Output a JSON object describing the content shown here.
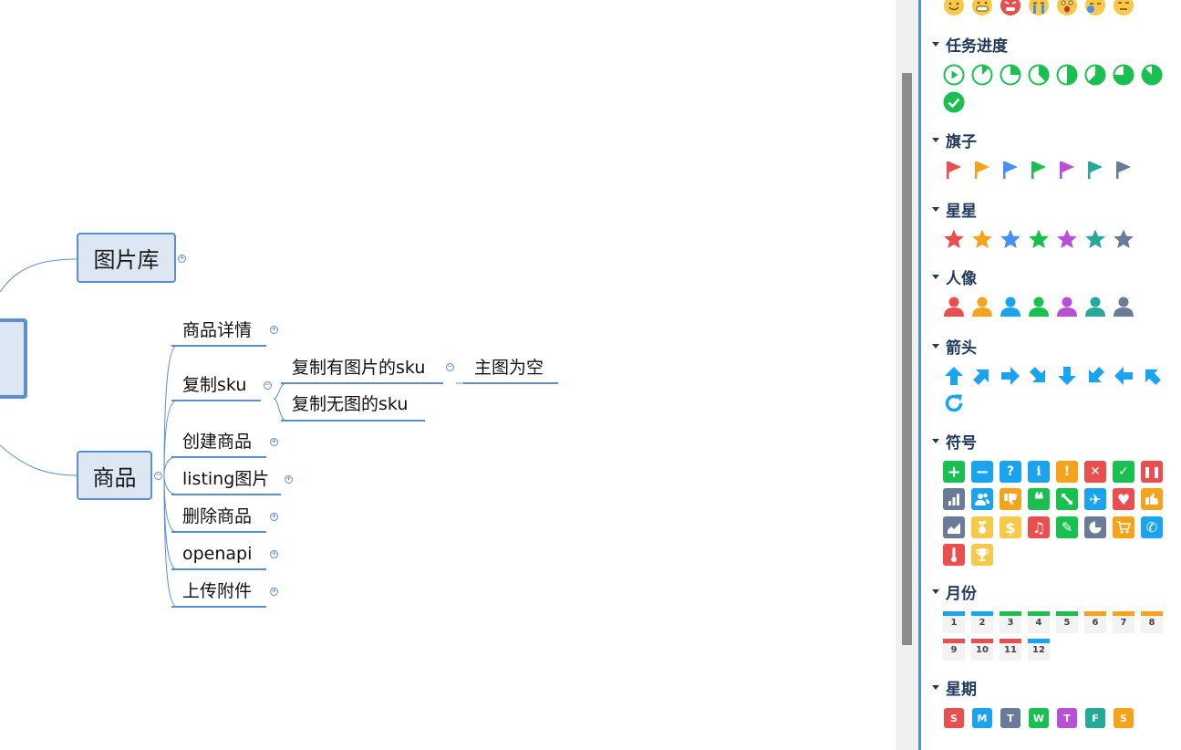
{
  "mindmap": {
    "topics": {
      "gallery": "图片库",
      "goods": "商品"
    },
    "goods_children": [
      "商品详情",
      "复制sku",
      "创建商品",
      "listing图片",
      "删除商品",
      "openapi",
      "上传附件"
    ],
    "copy_sku_children": [
      "复制有图片的sku",
      "复制无图的sku"
    ],
    "copy_with_image_children": [
      "主图为空"
    ]
  },
  "panel": {
    "sections": {
      "progress": "任务进度",
      "flags": "旗子",
      "stars": "星星",
      "avatars": "人像",
      "arrows": "箭头",
      "symbols": "符号",
      "months": "月份",
      "weekdays": "星期"
    },
    "months": [
      "1",
      "2",
      "3",
      "4",
      "5",
      "6",
      "7",
      "8",
      "9",
      "10",
      "11",
      "12"
    ],
    "weekdays": [
      "S",
      "M",
      "T",
      "W",
      "T",
      "F",
      "S"
    ],
    "colors": {
      "red": "#e94f4f",
      "orange": "#f7a21b",
      "blue": "#4a8ff0",
      "green": "#19c04f",
      "purple": "#b94fd6",
      "teal": "#27a99a",
      "gray": "#6a7a99",
      "sky": "#1aa3ef",
      "accent": "#4a90d9"
    },
    "emoji_icons": [
      "smile-icon",
      "grin-icon",
      "angry-icon",
      "crying-icon",
      "surprised-icon",
      "sleepy-icon",
      "neutral-icon"
    ],
    "progress_levels": [
      "start",
      "1/8",
      "2/8",
      "3/8",
      "4/8",
      "5/8",
      "6/8",
      "7/8",
      "done"
    ],
    "symbol_icons": [
      "plus-icon",
      "minus-icon",
      "question-icon",
      "info-icon",
      "exclamation-icon",
      "close-icon",
      "check-icon",
      "pause-icon",
      "bar-chart-icon",
      "users-icon",
      "thumbs-down-icon",
      "quote-icon",
      "expand-icon",
      "airplane-icon",
      "heart-icon",
      "thumbs-up-icon",
      "area-chart-icon",
      "medal-icon",
      "dollar-icon",
      "music-icon",
      "pencil-icon",
      "pie-chart-icon",
      "cart-icon",
      "phone-icon",
      "thermometer-icon",
      "trophy-icon"
    ]
  }
}
